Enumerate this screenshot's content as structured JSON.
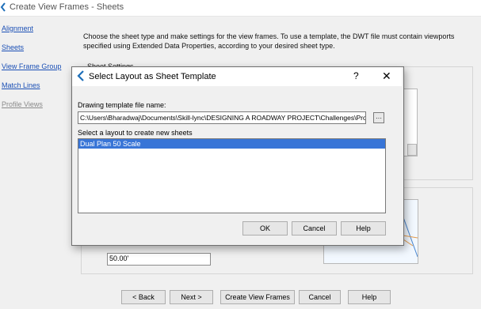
{
  "window": {
    "title": "Create View Frames - Sheets"
  },
  "nav": {
    "items": [
      {
        "label": "Alignment",
        "enabled": true
      },
      {
        "label": "Sheets",
        "enabled": true
      },
      {
        "label": "View Frame Group",
        "enabled": true
      },
      {
        "label": "Match Lines",
        "enabled": true
      },
      {
        "label": "Profile Views",
        "enabled": false
      }
    ]
  },
  "main": {
    "description": "Choose the sheet type and make settings for the view frames. To use a template, the DWT file must contain viewports specified using Extended Data Properties, according to your desired sheet type.",
    "sheet_settings_label": "Sheet Settings",
    "field_value": "50.00'"
  },
  "wizard_buttons": {
    "back": "< Back",
    "next": "Next >",
    "create": "Create View Frames",
    "cancel": "Cancel",
    "help": "Help"
  },
  "dialog": {
    "title": "Select Layout as Sheet Template",
    "help_glyph": "?",
    "close_glyph": "✕",
    "template_label": "Drawing template file name:",
    "template_path": "C:\\Users\\Bharadwaj\\Documents\\Skill-lync\\DESIGNING A ROADWAY PROJECT\\Challenges\\Proj",
    "browse_glyph": "···",
    "layout_label": "Select a layout to create new sheets",
    "layouts": [
      "Dual Plan 50 Scale"
    ],
    "buttons": {
      "ok": "OK",
      "cancel": "Cancel",
      "help": "Help"
    }
  },
  "colors": {
    "accent": "#3875d7",
    "link": "#1a4fb5",
    "dialog_bg": "#f0f0f0"
  }
}
